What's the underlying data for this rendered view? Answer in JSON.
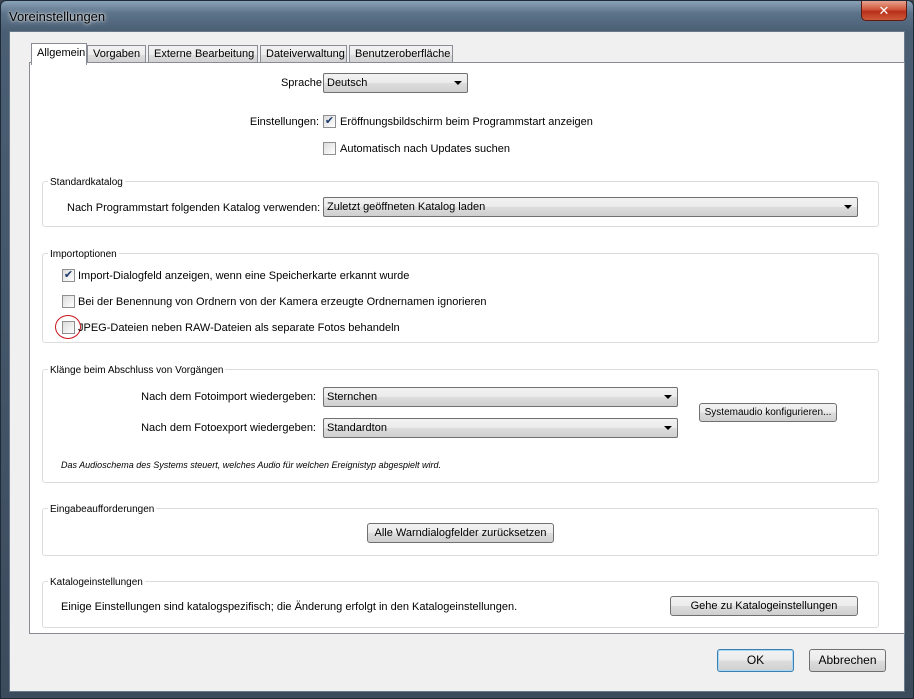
{
  "window": {
    "title": "Voreinstellungen",
    "close_label": "✕"
  },
  "tabs": [
    {
      "label": "Allgemein"
    },
    {
      "label": "Vorgaben"
    },
    {
      "label": "Externe Bearbeitung"
    },
    {
      "label": "Dateiverwaltung"
    },
    {
      "label": "Benutzeroberfläche"
    }
  ],
  "general": {
    "language_label": "Sprache:",
    "language_value": "Deutsch",
    "settings_label": "Einstellungen:",
    "show_splash_label": "Eröffnungsbildschirm beim Programmstart anzeigen",
    "show_splash_checked": "✔",
    "check_updates_label": "Automatisch nach Updates suchen",
    "check_updates_checked": ""
  },
  "standard_catalog": {
    "title": "Standardkatalog",
    "label": "Nach Programmstart folgenden Katalog verwenden:",
    "value": "Zuletzt geöffneten Katalog laden"
  },
  "import_options": {
    "title": "Importoptionen",
    "items": [
      {
        "label": "Import-Dialogfeld anzeigen, wenn eine Speicherkarte erkannt wurde",
        "checked": "✔"
      },
      {
        "label": "Bei der Benennung von Ordnern von der Kamera erzeugte Ordnernamen ignorieren",
        "checked": ""
      },
      {
        "label": "JPEG-Dateien neben RAW-Dateien als separate Fotos behandeln",
        "checked": ""
      }
    ]
  },
  "sounds": {
    "title": "Klänge beim Abschluss von Vorgängen",
    "import_label": "Nach dem Fotoimport wiedergeben:",
    "import_value": "Sternchen",
    "export_label": "Nach dem Fotoexport wiedergeben:",
    "export_value": "Standardton",
    "configure_button": "Systemaudio konfigurieren...",
    "note": "Das Audioschema des Systems steuert, welches Audio für welchen Ereignistyp abgespielt wird."
  },
  "prompts": {
    "title": "Eingabeaufforderungen",
    "reset_button": "Alle Warndialogfelder zurücksetzen"
  },
  "catalog_settings": {
    "title": "Katalogeinstellungen",
    "text": "Einige Einstellungen sind katalogspezifisch; die Änderung erfolgt in den Katalogeinstellungen.",
    "button": "Gehe zu Katalogeinstellungen"
  },
  "footer": {
    "ok": "OK",
    "cancel": "Abbrechen"
  }
}
